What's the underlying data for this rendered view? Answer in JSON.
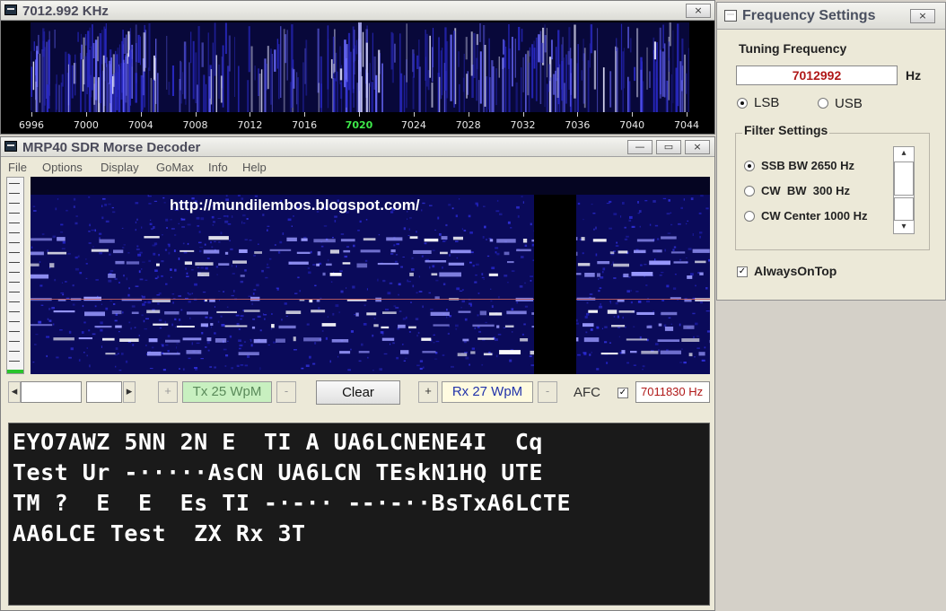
{
  "spectrum_window": {
    "title": "7012.992 KHz",
    "close_label": "×",
    "ticks": [
      "6996",
      "7000",
      "7004",
      "7008",
      "7012",
      "7016",
      "7020",
      "7024",
      "7028",
      "7032",
      "7036",
      "7040",
      "7044"
    ],
    "highlight_tick": "7020"
  },
  "decoder_window": {
    "title": "MRP40 SDR Morse Decoder",
    "minimize_label": "—",
    "maximize_label": "▭",
    "close_label": "×",
    "menu": [
      "File",
      "Options",
      "Display",
      "GoMax",
      "Info",
      "Help"
    ],
    "overlay_url": "http://mundilembos.blogspot.com/",
    "controls": {
      "scroll_left": "◂",
      "scroll_right": "▸",
      "tx_plus": "+",
      "tx_label": "Tx 25 WpM",
      "tx_minus": "-",
      "clear_label": "Clear",
      "rx_plus": "+",
      "rx_label": "Rx 27 WpM",
      "rx_minus": "-",
      "afc_label": "AFC",
      "afc_check": "✓",
      "freq_value": "7011830 Hz"
    },
    "decoded_lines": [
      "EYO7AWZ 5NN 2N E  TI A UA6LCNENE4I  Cq",
      "Test Ur -·····AsCN UA6LCN TEskN1HQ UTE",
      "TM ?  E  E  Es TI -·-·· --·-··BsTxA6LCTE",
      "AA6LCE Test  ZX Rx 3T"
    ]
  },
  "freq_settings": {
    "title": "Frequency Settings",
    "close_label": "×",
    "tuning_label": "Tuning Frequency",
    "tuning_value": "7012992",
    "unit": "Hz",
    "lsb_label": "LSB",
    "usb_label": "USB",
    "filter_title": "Filter Settings",
    "filters": [
      "SSB BW 2650 Hz",
      "CW  BW  300 Hz",
      "CW Center 1000 Hz"
    ],
    "always_on_top": "AlwaysOnTop",
    "check_mark": "✓",
    "scroll_up": "▴",
    "scroll_down": "▾"
  }
}
